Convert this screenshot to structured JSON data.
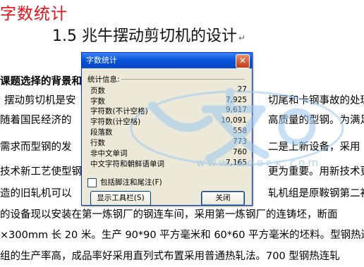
{
  "document": {
    "red_title": "字数统计",
    "heading": "1.5 兆牛摆动剪切机的设计",
    "paragraph_mark": "↵",
    "section_heading": "课题选择的背景和",
    "lines_left": [
      "摆动剪切机是安",
      "随着国民经济的",
      "需求而型钢的发",
      "技术新工艺使型钢",
      "造的旧轧机可以",
      "的设备现以安装在第一炼钢厂的钢连车间，采用第一炼钢厂的连铸坯，断面",
      "×300mm 长 20 米。生产 90*90 平方毫米和 60*60 平方毫米的坯料。型钢热连",
      "组的生产率高，成品率好采用直列式布置采用普通热轧法。700 型钢热连轧"
    ],
    "lines_right": [
      "切尾和卡钢事故的处理",
      "高质量的型钢。为满足",
      "二是上新设备，采用",
      "更为重要。用新技术更",
      "轧机组是原鞍钢第二初"
    ]
  },
  "watermark": {
    "text": "www.wdocx.com"
  },
  "dialog": {
    "title": "字数统计",
    "close_glyph": "✕",
    "info_label": "统计信息:",
    "stats": [
      {
        "label": "页数",
        "value": "27"
      },
      {
        "label": "字数",
        "value": "7,925"
      },
      {
        "label": "字符数(不计空格)",
        "value": "9,617"
      },
      {
        "label": "字符数(计空格)",
        "value": "10,091"
      },
      {
        "label": "段落数",
        "value": "558"
      },
      {
        "label": "行数",
        "value": "773"
      },
      {
        "label": "非中文单词",
        "value": "760"
      },
      {
        "label": "中文字符和朝鲜语单词",
        "value": "7,165"
      }
    ],
    "checkbox_label": "包括脚注和尾注(F)",
    "checkbox_checked": false,
    "show_toolbar_button": "显示工具栏(S)",
    "close_button": "关闭"
  },
  "colors": {
    "red_title": "#e8101a",
    "titlebar": "#0a55dc",
    "dialog_bg": "#ece9d8"
  }
}
